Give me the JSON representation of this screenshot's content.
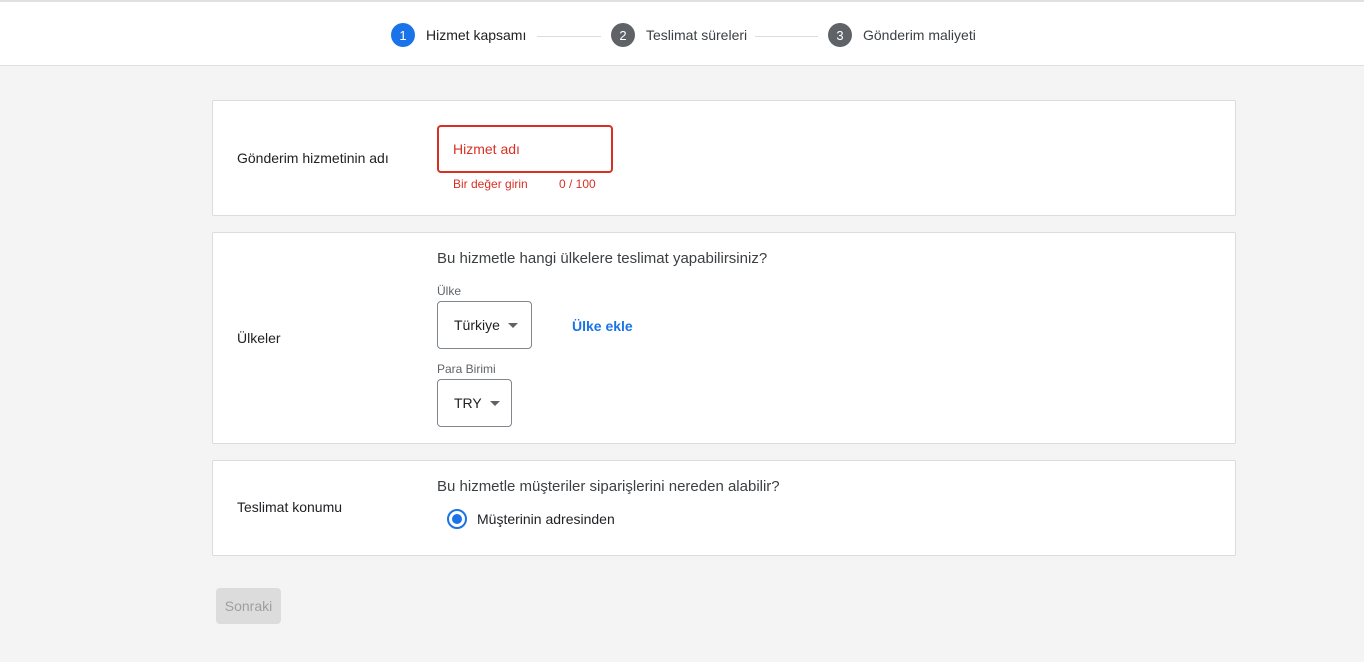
{
  "stepper": {
    "steps": [
      {
        "number": "1",
        "label": "Hizmet kapsamı"
      },
      {
        "number": "2",
        "label": "Teslimat süreleri"
      },
      {
        "number": "3",
        "label": "Gönderim maliyeti"
      }
    ]
  },
  "service_name": {
    "label": "Gönderim hizmetinin adı",
    "placeholder": "Hizmet adı",
    "value": "",
    "error": "Bir değer girin",
    "counter": "0 / 100"
  },
  "countries": {
    "label": "Ülkeler",
    "question": "Bu hizmetle hangi ülkelere teslimat yapabilirsiniz?",
    "country_label": "Ülke",
    "country_value": "Türkiye",
    "add_country": "Ülke ekle",
    "currency_label": "Para Birimi",
    "currency_value": "TRY"
  },
  "delivery_location": {
    "label": "Teslimat konumu",
    "question": "Bu hizmetle müşteriler siparişlerini nereden alabilir?",
    "option": "Müşterinin adresinden"
  },
  "footer": {
    "next_label": "Sonraki"
  },
  "colors": {
    "accent": "#1a73e8",
    "error": "#d93025"
  }
}
